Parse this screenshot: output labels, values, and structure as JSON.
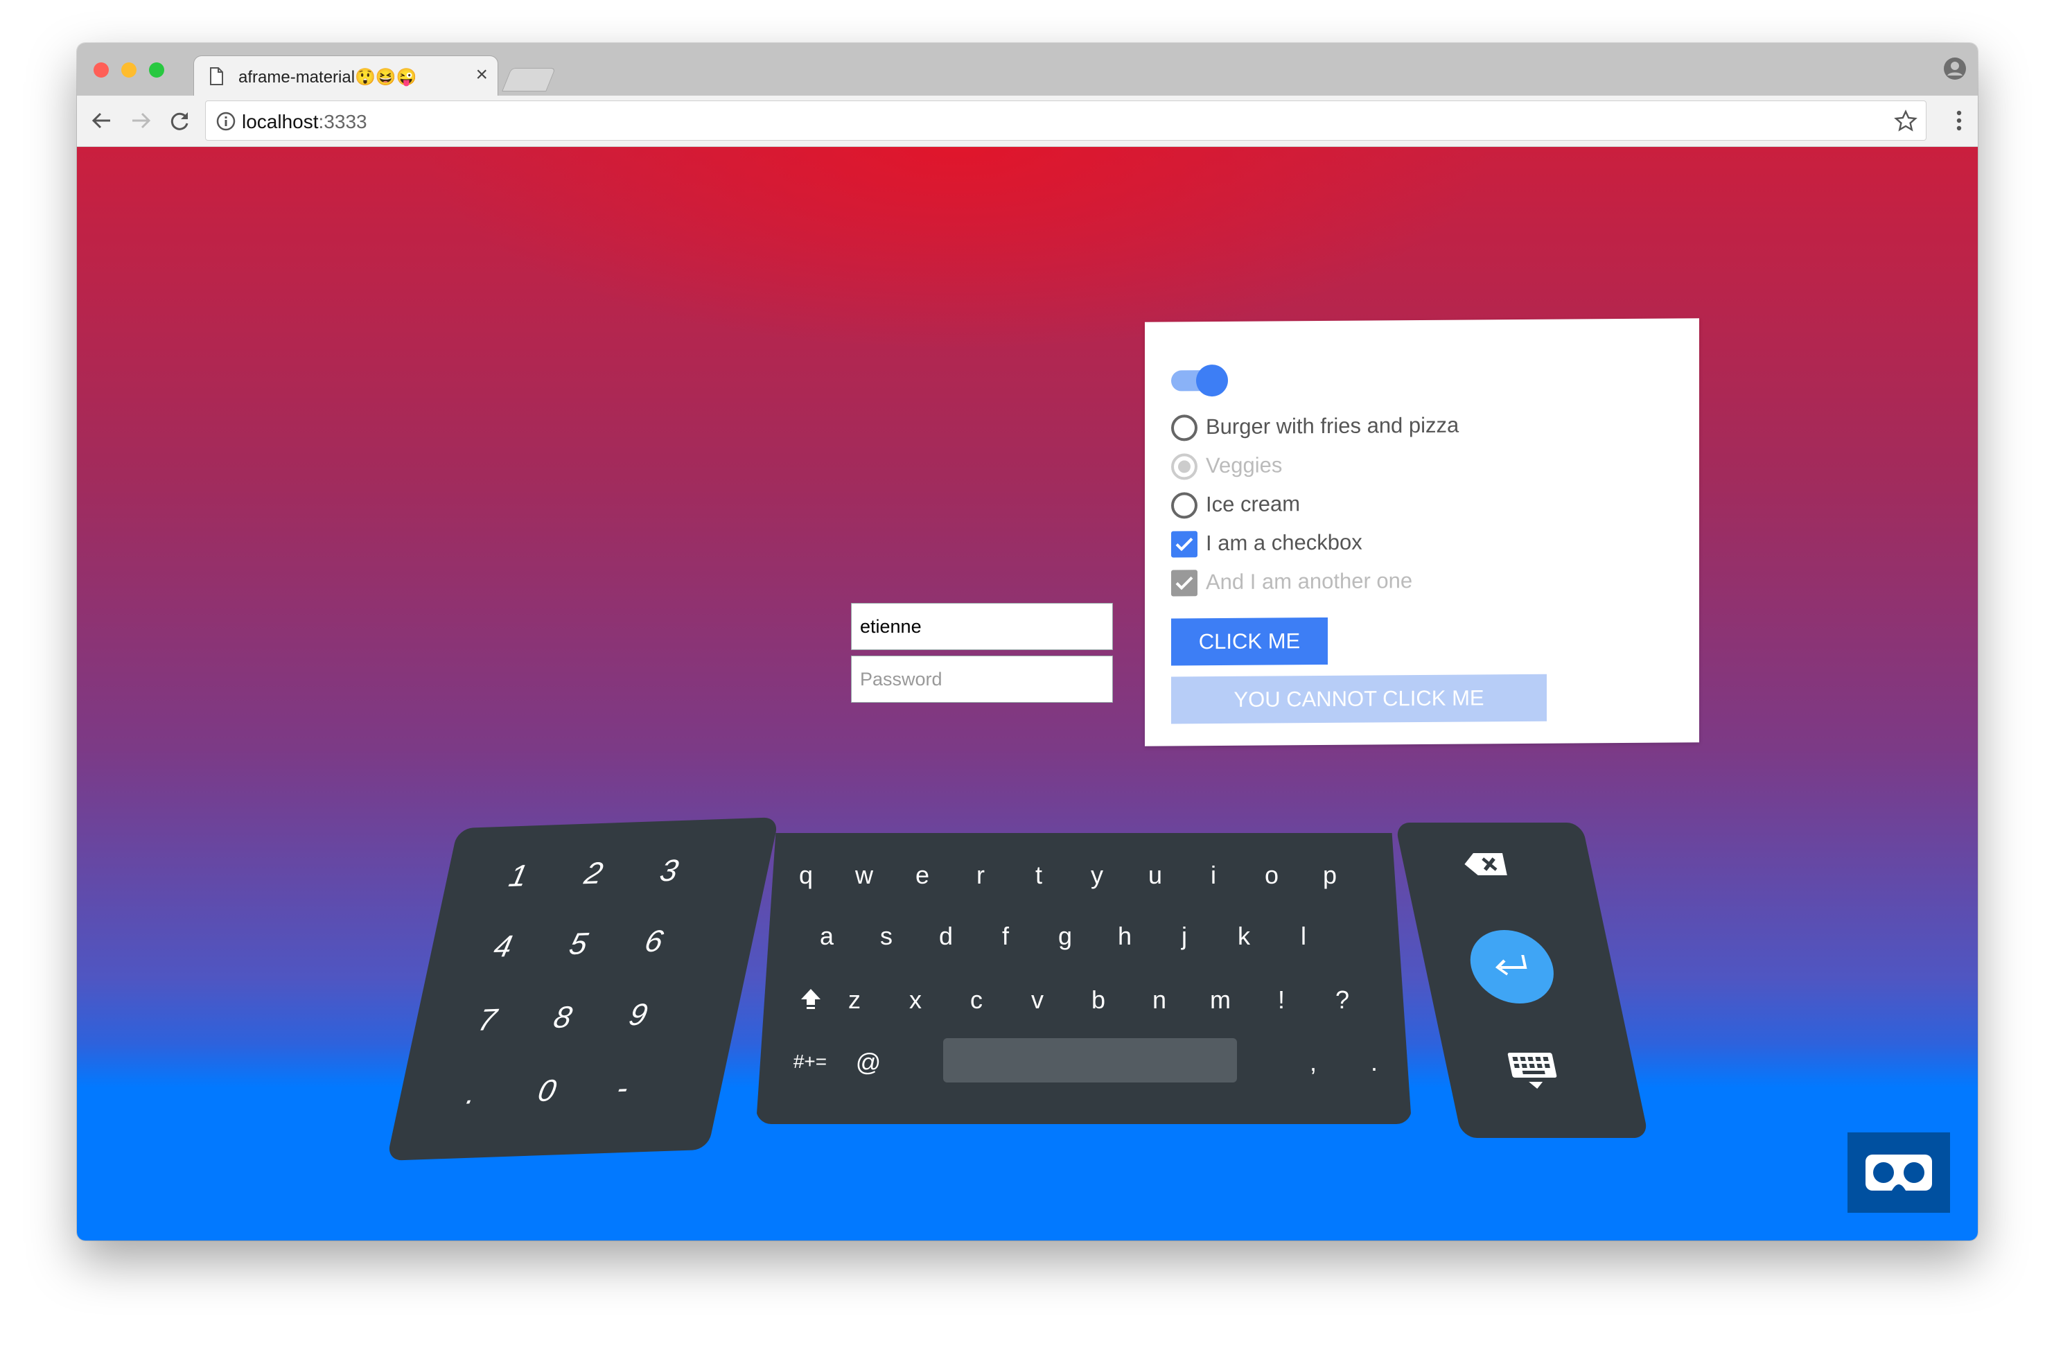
{
  "browser": {
    "tab_title": "aframe-material😲😆😜",
    "tab_close": "×",
    "url_host": "localhost",
    "url_port": ":3333",
    "traffic_lights": [
      "#ff5f57",
      "#febc2e",
      "#28c840"
    ]
  },
  "form": {
    "username_value": "etienne",
    "password_placeholder": "Password"
  },
  "panel": {
    "toggle_on": true,
    "radios": [
      {
        "label": "Burger with fries and pizza",
        "disabled": false
      },
      {
        "label": "Veggies",
        "disabled": true
      },
      {
        "label": "Ice cream",
        "disabled": false
      }
    ],
    "checkboxes": [
      {
        "label": "I am a checkbox",
        "checked": true,
        "disabled": false
      },
      {
        "label": "And I am another one",
        "checked": true,
        "disabled": true
      }
    ],
    "button_enabled": "CLICK ME",
    "button_disabled": "YOU CANNOT CLICK ME"
  },
  "keyboard": {
    "numpad": [
      "1",
      "2",
      "3",
      "4",
      "5",
      "6",
      "7",
      "8",
      "9",
      ".",
      "0",
      "-"
    ],
    "row1": [
      "q",
      "w",
      "e",
      "r",
      "t",
      "y",
      "u",
      "i",
      "o",
      "p"
    ],
    "row2": [
      "a",
      "s",
      "d",
      "f",
      "g",
      "h",
      "j",
      "k",
      "l"
    ],
    "row3": [
      "z",
      "x",
      "c",
      "v",
      "b",
      "n",
      "m",
      "!",
      "?"
    ],
    "row4_left": [
      "#+=",
      "@"
    ],
    "row4_right": [
      ",",
      "."
    ]
  },
  "colors": {
    "accent": "#3d7ef5",
    "sky_top": "#ca1f3e",
    "ground": "#0279ff",
    "keyboard": "#333b41"
  }
}
